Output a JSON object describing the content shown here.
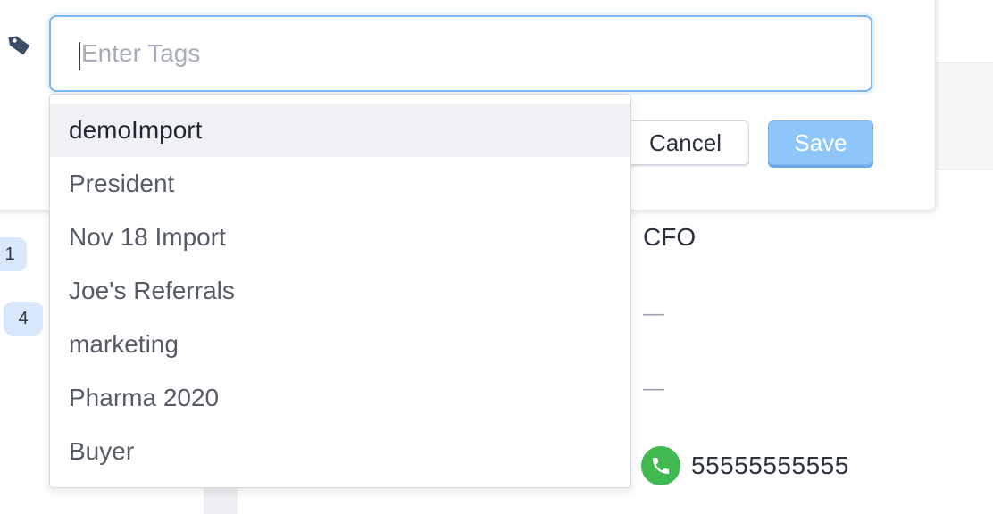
{
  "tag_input": {
    "placeholder": "Enter Tags",
    "value": ""
  },
  "buttons": {
    "cancel": "Cancel",
    "save": "Save"
  },
  "suggestions": [
    {
      "label": "demoImport",
      "highlighted": true
    },
    {
      "label": "President",
      "highlighted": false
    },
    {
      "label": "Nov 18 Import",
      "highlighted": false
    },
    {
      "label": "Joe's Referrals",
      "highlighted": false
    },
    {
      "label": "marketing",
      "highlighted": false
    },
    {
      "label": "Pharma 2020",
      "highlighted": false
    },
    {
      "label": "Buyer",
      "highlighted": false
    }
  ],
  "background": {
    "badges": [
      "1",
      "4"
    ],
    "title": "CFO",
    "dash_1": "—",
    "dash_2": "—",
    "phone": "55555555555"
  },
  "colors": {
    "accent": "#7fb7f3",
    "save_button": "#8cc6fb",
    "phone_icon": "#3fb950",
    "highlight_row": "#eff1f4"
  },
  "icons": [
    "tag-icon",
    "phone-icon"
  ]
}
